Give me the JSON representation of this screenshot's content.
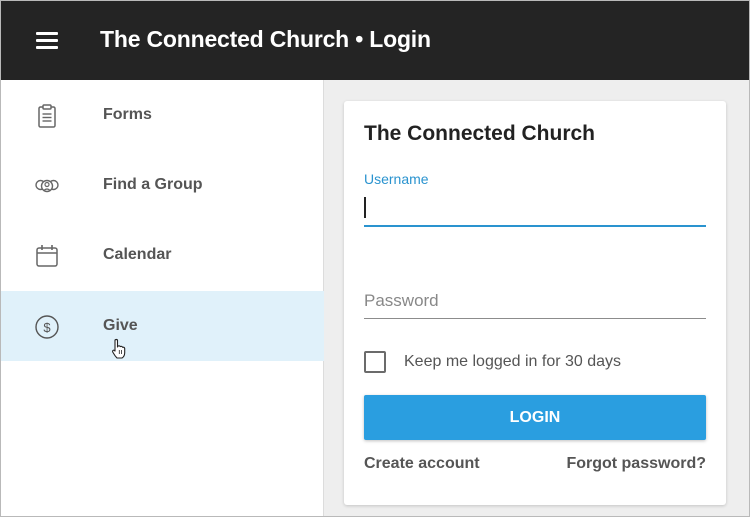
{
  "header": {
    "title": "The Connected Church • Login"
  },
  "sidebar": {
    "items": [
      {
        "label": "Forms",
        "icon": "clipboard-icon"
      },
      {
        "label": "Find a Group",
        "icon": "group-icon"
      },
      {
        "label": "Calendar",
        "icon": "calendar-icon"
      },
      {
        "label": "Give",
        "icon": "dollar-circle-icon",
        "active": true
      }
    ]
  },
  "login": {
    "title": "The Connected Church",
    "username_label": "Username",
    "username_value": "",
    "password_placeholder": "Password",
    "password_value": "",
    "remember_label": "Keep me logged in for 30 days",
    "remember_checked": false,
    "login_button": "LOGIN",
    "create_account": "Create account",
    "forgot_password": "Forgot password?"
  },
  "colors": {
    "topbar": "#242424",
    "accent": "#2a9ee0",
    "active_item_bg": "#e0f1fa",
    "label_blue": "#2a93cf"
  }
}
